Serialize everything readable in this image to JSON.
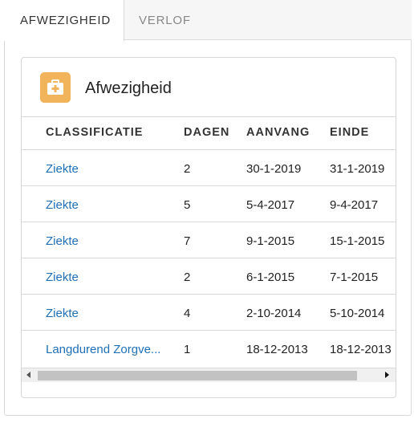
{
  "tabs": [
    {
      "label": "AFWEZIGHEID",
      "active": true
    },
    {
      "label": "VERLOF",
      "active": false
    }
  ],
  "card": {
    "icon": "medical-briefcase-icon",
    "icon_color": "#f2b45a",
    "title": "Afwezigheid"
  },
  "table": {
    "headers": {
      "classificatie": "CLASSIFICATIE",
      "dagen": "DAGEN",
      "aanvang": "AANVANG",
      "einde": "EINDE"
    },
    "rows": [
      {
        "classificatie": "Ziekte",
        "dagen": "2",
        "aanvang": "30-1-2019",
        "einde": "31-1-2019"
      },
      {
        "classificatie": "Ziekte",
        "dagen": "5",
        "aanvang": "5-4-2017",
        "einde": "9-4-2017"
      },
      {
        "classificatie": "Ziekte",
        "dagen": "7",
        "aanvang": "9-1-2015",
        "einde": "15-1-2015"
      },
      {
        "classificatie": "Ziekte",
        "dagen": "2",
        "aanvang": "6-1-2015",
        "einde": "7-1-2015"
      },
      {
        "classificatie": "Ziekte",
        "dagen": "4",
        "aanvang": "2-10-2014",
        "einde": "5-10-2014"
      },
      {
        "classificatie": "Langdurend Zorgve...",
        "dagen": "1",
        "aanvang": "18-12-2013",
        "einde": "18-12-2013"
      }
    ]
  },
  "link_color": "#1f6fb6"
}
